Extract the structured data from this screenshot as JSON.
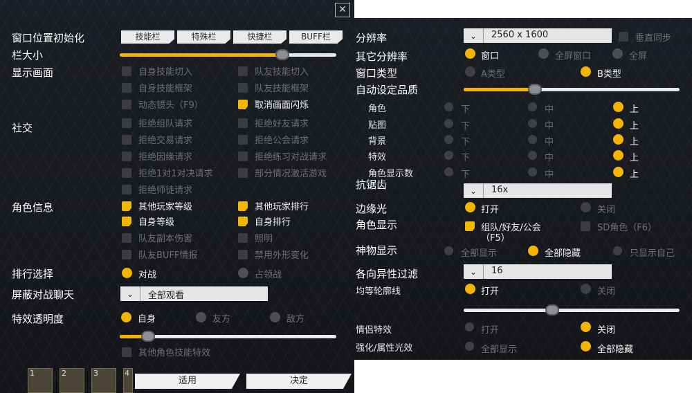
{
  "left": {
    "close_label": "✕",
    "window_pos": {
      "label": "窗口位置初始化",
      "tabs": [
        "技能栏",
        "特殊栏",
        "快捷栏",
        "BUFF栏"
      ]
    },
    "bar_size": {
      "label": "栏大小",
      "value": 0.75
    },
    "display": {
      "label": "显示画面",
      "items": [
        {
          "text": "自身技能切入",
          "checked": false,
          "enabled": false
        },
        {
          "text": "队友技能切入",
          "checked": false,
          "enabled": false
        },
        {
          "text": "自身技能框架",
          "checked": false,
          "enabled": false
        },
        {
          "text": "队友技能框架",
          "checked": false,
          "enabled": false
        },
        {
          "text": "动态镜头（F9）",
          "checked": false,
          "enabled": false
        },
        {
          "text": "取消画面闪烁",
          "checked": true,
          "enabled": true
        }
      ]
    },
    "social": {
      "label": "社交",
      "items": [
        {
          "text": "拒绝组队请求"
        },
        {
          "text": "拒绝好友请求"
        },
        {
          "text": "拒绝交易请求"
        },
        {
          "text": "拒绝公会请求"
        },
        {
          "text": "拒绝因缘请求"
        },
        {
          "text": "拒绝练习对战请求"
        },
        {
          "text": "拒绝1对1对决请求"
        },
        {
          "text": "部分情况激活游戏"
        },
        {
          "text": "拒绝师徒请求"
        }
      ]
    },
    "char_info": {
      "label": "角色信息",
      "items": [
        {
          "text": "其他玩家等级",
          "checked": true,
          "enabled": true
        },
        {
          "text": "其他玩家排行",
          "checked": true,
          "enabled": true
        },
        {
          "text": "自身等级",
          "checked": true,
          "enabled": true
        },
        {
          "text": "自身排行",
          "checked": true,
          "enabled": true
        },
        {
          "text": "队友副本伤害",
          "checked": false,
          "enabled": false
        },
        {
          "text": "照明",
          "checked": false,
          "enabled": false
        },
        {
          "text": "队友BUFF情报",
          "checked": false,
          "enabled": false
        },
        {
          "text": "禁用外形变化",
          "checked": false,
          "enabled": false
        }
      ]
    },
    "rank_select": {
      "label": "排行选择",
      "options": [
        "对战",
        "占领战"
      ],
      "selected": 0
    },
    "block_chat": {
      "label": "屏蔽对战聊天",
      "arrow": "⌄",
      "value": "全部观看"
    },
    "effect_alpha": {
      "label": "特效透明度",
      "options": [
        "自身",
        "友方",
        "敌方"
      ],
      "selected": 0,
      "value": 0.13,
      "other": "其他角色技能特效"
    },
    "slots": [
      "1",
      "2",
      "3",
      "4"
    ],
    "apply_label": "适用",
    "confirm_label": "决定"
  },
  "right": {
    "resolution": {
      "label": "分辨率",
      "arrow": "⌄",
      "value": "2560 x 1600",
      "vsync": "垂直同步"
    },
    "other_res": {
      "label": "其它分辨率",
      "options": [
        "窗口",
        "全屏窗口",
        "全屏"
      ],
      "selected": 0
    },
    "window_type": {
      "label": "窗口类型",
      "options": [
        "A类型",
        "B类型"
      ],
      "selected": 1
    },
    "auto_quality": {
      "label": "自动设定品质",
      "value": 0.33
    },
    "quality_rows": [
      {
        "label": "角色",
        "options": [
          "下",
          "中",
          "上"
        ],
        "selected": 2
      },
      {
        "label": "贴图",
        "options": [
          "下",
          "中",
          "上"
        ],
        "selected": 2
      },
      {
        "label": "背景",
        "options": [
          "下",
          "中",
          "上"
        ],
        "selected": 2
      },
      {
        "label": "特效",
        "options": [
          "下",
          "中",
          "上"
        ],
        "selected": 2
      },
      {
        "label": "角色显示数",
        "options": [
          "下",
          "中",
          "上"
        ],
        "selected": 2
      }
    ],
    "antialias": {
      "label": "抗锯齿",
      "arrow": "⌄",
      "value": "16x"
    },
    "edge_light": {
      "label": "边缘光",
      "options": [
        "打开",
        "关闭"
      ],
      "selected": 0
    },
    "char_display": {
      "label": "角色显示",
      "opt1": "组队/好友/公会",
      "opt1b": "（F5）",
      "opt2": "SD角色（F6）"
    },
    "artifact": {
      "label": "神物显示",
      "options": [
        "全部显示",
        "全部隐藏",
        "只显示自己"
      ],
      "selected": 1
    },
    "aniso": {
      "label": "各向异性过滤",
      "arrow": "⌄",
      "value": "16"
    },
    "outline": {
      "label": "均等轮廓线",
      "options": [
        "打开",
        "关闭"
      ],
      "selected": 0,
      "value": 0.41
    },
    "couple": {
      "label": "情侣特效",
      "options": [
        "打开",
        "关闭"
      ],
      "selected": 1
    },
    "enhance": {
      "label": "强化/属性光效",
      "options": [
        "全部显示",
        "全部隐藏"
      ],
      "selected": 1
    }
  },
  "colors": {
    "accent": "#f4b400",
    "panel": "#16181c",
    "disabled": "#6d6f74"
  }
}
